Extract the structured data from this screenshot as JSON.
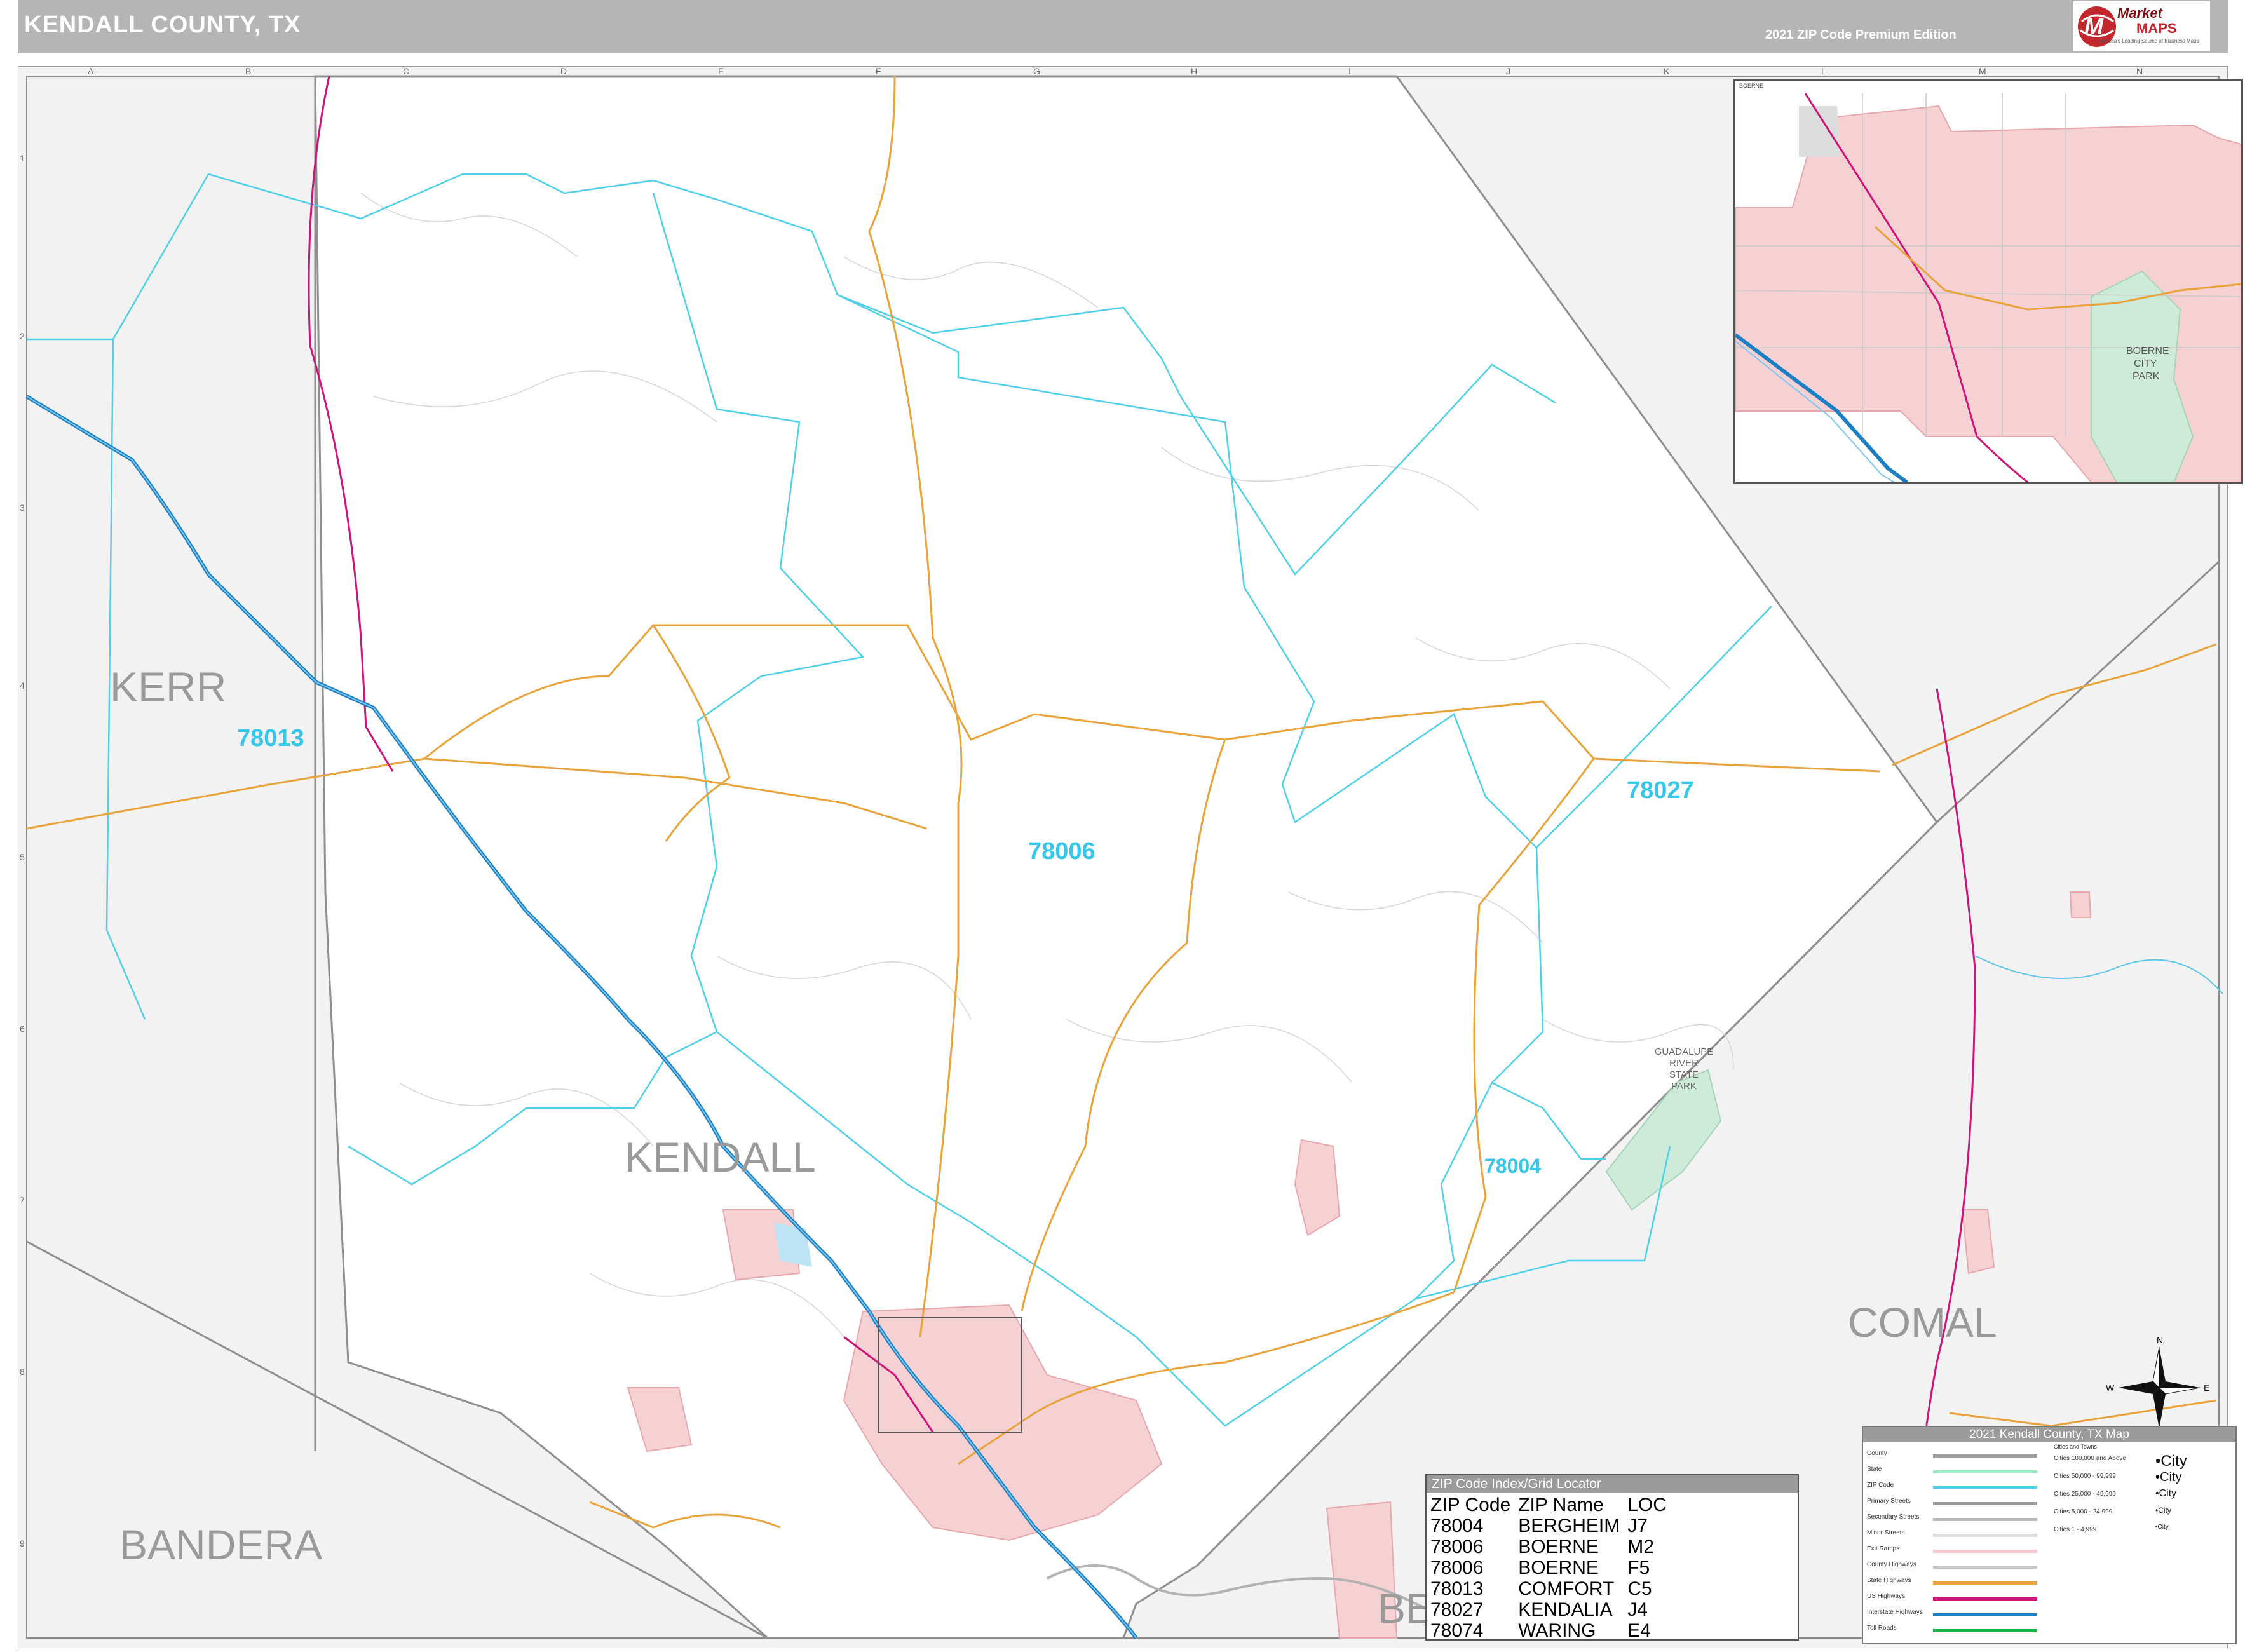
{
  "header": {
    "title": "KENDALL COUNTY, TX",
    "edition": "2021 ZIP Code Premium Edition",
    "logo_brand_top": "Market",
    "logo_brand_bottom": "MAPS",
    "logo_tagline": "America's Leading Source of Business Maps"
  },
  "grid": {
    "columns": [
      "A",
      "B",
      "C",
      "D",
      "E",
      "F",
      "G",
      "H",
      "I",
      "J",
      "K",
      "L",
      "M",
      "N"
    ],
    "rows": [
      "1",
      "2",
      "3",
      "4",
      "5",
      "6",
      "7",
      "8",
      "9"
    ]
  },
  "counties": {
    "main": "KENDALL",
    "neighbors": [
      "KERR",
      "COMAL",
      "BANDERA",
      "BE"
    ]
  },
  "zip_labels": [
    "78013",
    "78006",
    "78027",
    "78004"
  ],
  "park_label": [
    "GUADALUPE",
    "RIVER",
    "STATE",
    "PARK"
  ],
  "inset": {
    "title": "BOERNE",
    "park_label": [
      "BOERNE",
      "CITY",
      "PARK"
    ]
  },
  "zip_index": {
    "title": "ZIP Code Index/Grid Locator",
    "headers": [
      "ZIP Code",
      "ZIP Name",
      "LOC"
    ],
    "rows": [
      [
        "78004",
        "BERGHEIM",
        "J7"
      ],
      [
        "78006",
        "BOERNE",
        "M2"
      ],
      [
        "78006",
        "BOERNE",
        "F5"
      ],
      [
        "78013",
        "COMFORT",
        "C5"
      ],
      [
        "78027",
        "KENDALIA",
        "J4"
      ],
      [
        "78074",
        "WARING",
        "E4"
      ]
    ]
  },
  "legend": {
    "title": "2021 Kendall County, TX Map",
    "items": [
      {
        "label": "County",
        "color": "#9e9e9e"
      },
      {
        "label": "State",
        "color": "#9fe6c2"
      },
      {
        "label": "ZIP Code",
        "color": "#4fd0e8"
      },
      {
        "label": "Primary Streets",
        "color": "#999999"
      },
      {
        "label": "Secondary Streets",
        "color": "#bbbbbb"
      },
      {
        "label": "Minor Streets",
        "color": "#dddddd"
      },
      {
        "label": "Exit Ramps",
        "color": "#f3c7cf"
      },
      {
        "label": "County Highways",
        "color": "#c8c8c8"
      },
      {
        "label": "State Highways",
        "color": "#e8a33b"
      },
      {
        "label": "US Highways",
        "color": "#d1127a"
      },
      {
        "label": "Interstate Highways",
        "color": "#1b7fc4"
      },
      {
        "label": "Toll Roads",
        "color": "#1bb34a"
      }
    ],
    "cities_heading": "Cities and Towns",
    "cities": [
      {
        "label": "Cities 100,000 and Above",
        "sample": "•City"
      },
      {
        "label": "Cities 50,000 - 99,999",
        "sample": "•City"
      },
      {
        "label": "Cities 25,000 - 49,999",
        "sample": "•City"
      },
      {
        "label": "Cities 5,000 - 24,999",
        "sample": "•City"
      },
      {
        "label": "Cities 1 - 4,999",
        "sample": "•City"
      }
    ]
  },
  "colors": {
    "header_gray": "#b5b5b5",
    "outside_county": "#f2f2f2",
    "zip_boundary": "#4fd0e8",
    "state_highway": "#e8a33b",
    "us_highway": "#d1127a",
    "interstate": "#1b7fc4",
    "urban": "#f6d1d4",
    "park": "#cdebd8"
  }
}
